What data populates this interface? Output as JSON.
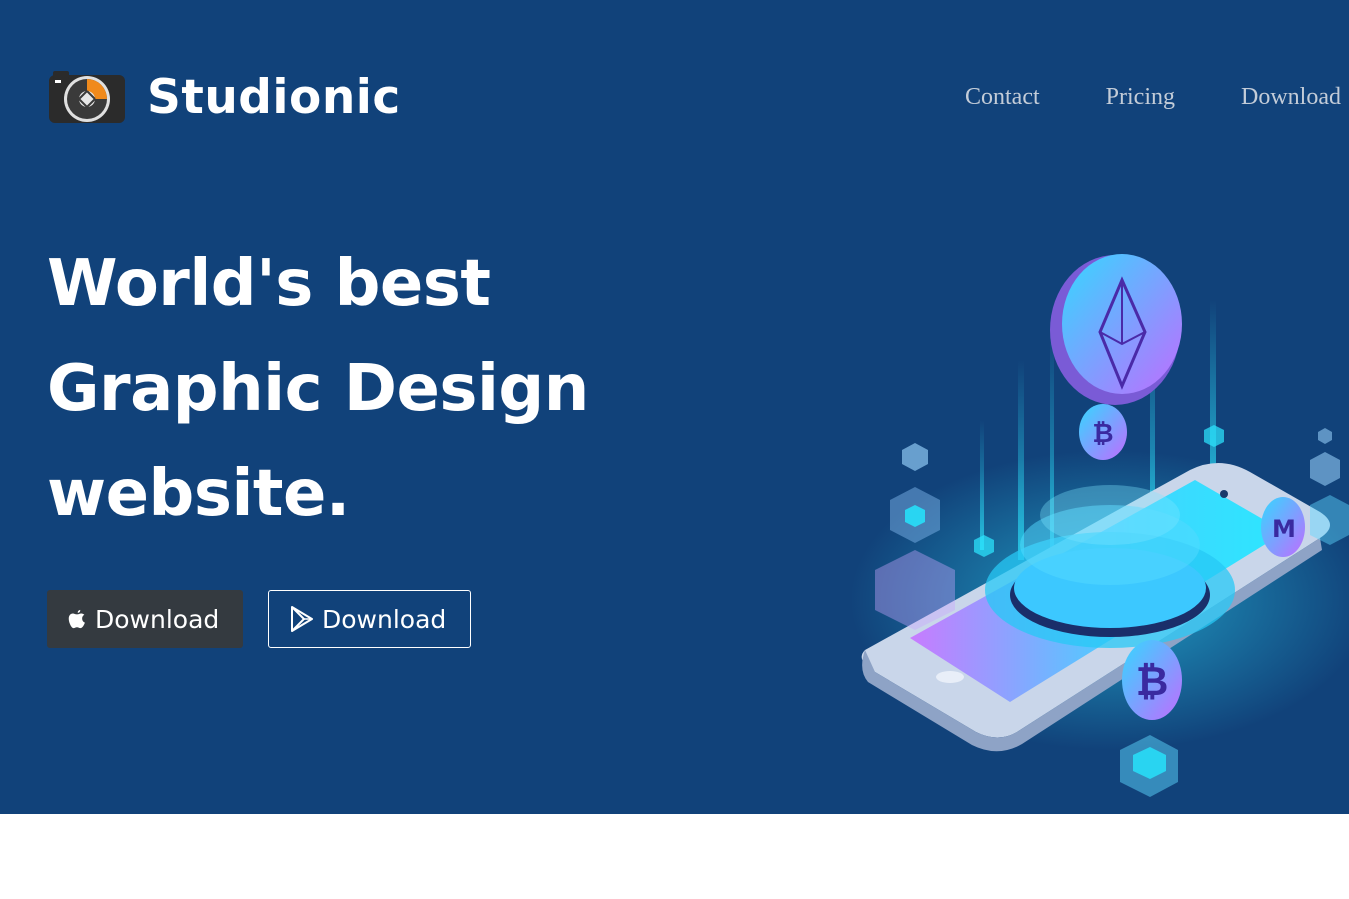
{
  "brand": {
    "name": "Studionic",
    "logo_icon": "camera-aperture-icon"
  },
  "nav": {
    "items": [
      "Contact",
      "Pricing",
      "Download"
    ]
  },
  "hero": {
    "headline": [
      "World's best",
      "Graphic Design",
      "website."
    ],
    "buttons": [
      {
        "label": "Download",
        "icon": "apple-icon"
      },
      {
        "label": "Download",
        "icon": "google-play-icon"
      }
    ],
    "illustration_icon": "isometric-phone-crypto-illustration"
  },
  "colors": {
    "hero_background": "#11427a",
    "button_dark": "#343a40",
    "nav_text": "#c3ccd8",
    "accent_cyan": "#2de6ff",
    "accent_violet": "#b070ff"
  }
}
